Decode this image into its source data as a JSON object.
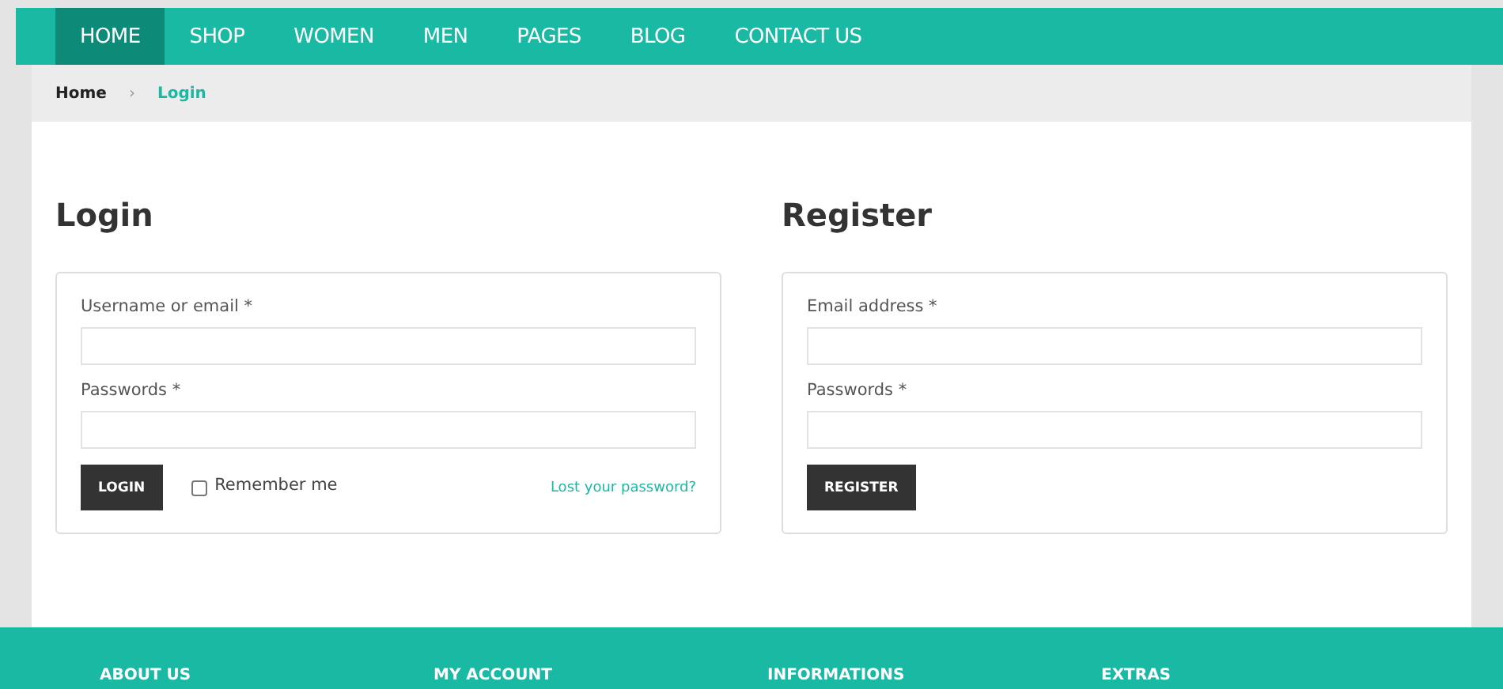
{
  "nav": {
    "items": [
      {
        "label": "HOME",
        "selected": true
      },
      {
        "label": "SHOP",
        "selected": false
      },
      {
        "label": "WOMEN",
        "selected": false
      },
      {
        "label": "MEN",
        "selected": false
      },
      {
        "label": "PAGES",
        "selected": false
      },
      {
        "label": "BLOG",
        "selected": false
      },
      {
        "label": "CONTACT US",
        "selected": false
      }
    ]
  },
  "breadcrumb": {
    "items": [
      "Home",
      "Login"
    ],
    "separator": "›"
  },
  "login": {
    "title": "Login",
    "fields": [
      {
        "label": "Username or email *"
      },
      {
        "label": "Passwords *"
      }
    ],
    "button": "LOGIN",
    "remember": {
      "label": "Remember me",
      "checked": false
    },
    "lost_link": "Lost your password?"
  },
  "register": {
    "title": "Register",
    "fields": [
      {
        "label": "Email address *"
      },
      {
        "label": "Passwords *"
      }
    ],
    "button": "REGISTER"
  },
  "footer": {
    "headings": [
      "ABOUT US",
      "MY ACCOUNT",
      "INFORMATIONS",
      "EXTRAS"
    ]
  }
}
